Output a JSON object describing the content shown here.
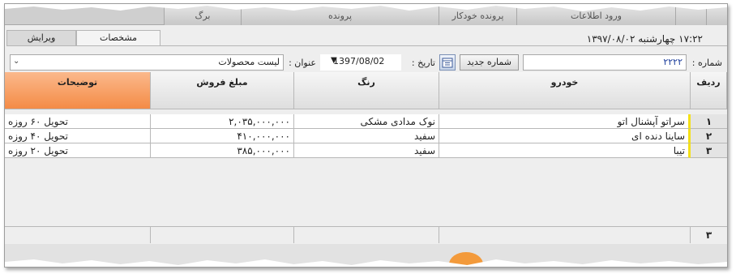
{
  "topnav": {
    "tabs": [
      "برگ",
      "پرونده",
      "پرونده خودکار",
      "ورود اطلاعات"
    ]
  },
  "subtabs": {
    "edit": "ویرایش",
    "specs": "مشخصات"
  },
  "header": {
    "datetime": "۱۷:۲۲   چهارشنبه ۱۳۹۷/۰۸/۰۲"
  },
  "form": {
    "number_label": "شماره :",
    "number_value": "۲۲۲۲",
    "new_number_button": "شماره جدید",
    "date_label": "تاریخ :",
    "date_value": "1397/08/02",
    "title_label": "عنوان :",
    "title_value": "لیست محصولات"
  },
  "grid": {
    "columns": {
      "index": "ردیف",
      "car": "خودرو",
      "color": "رنگ",
      "price": "مبلغ فروش",
      "desc": "توضیحات"
    },
    "rows": [
      {
        "index": "۱",
        "car": "سراتو آپشنال اتو",
        "color": "نوک مدادی مشکی",
        "price": "۲,۰۳۵,۰۰۰,۰۰۰",
        "desc": "تحویل ۶۰ روزه"
      },
      {
        "index": "۲",
        "car": "ساینا دنده ای",
        "color": "سفید",
        "price": "۴۱۰,۰۰۰,۰۰۰",
        "desc": "تحویل ۴۰ روزه"
      },
      {
        "index": "۳",
        "car": "تیبا",
        "color": "سفید",
        "price": "۳۸۵,۰۰۰,۰۰۰",
        "desc": "تحویل  ۲۰ روزه"
      }
    ],
    "footer_count": "۳"
  },
  "colors": {
    "accent_orange": "#f48b46",
    "row_marker": "#f4e017"
  }
}
